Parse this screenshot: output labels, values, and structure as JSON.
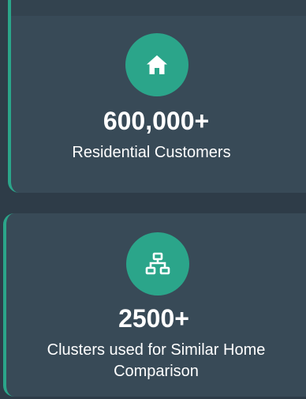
{
  "colors": {
    "accent": "#2ba58a",
    "card": "#384a57",
    "background": "#2e3c48"
  },
  "stats": [
    {
      "icon": "home-icon",
      "value": "600,000+",
      "label": "Residential Customers"
    },
    {
      "icon": "network-icon",
      "value": "2500+",
      "label": "Clusters used for Similar Home Comparison"
    }
  ]
}
